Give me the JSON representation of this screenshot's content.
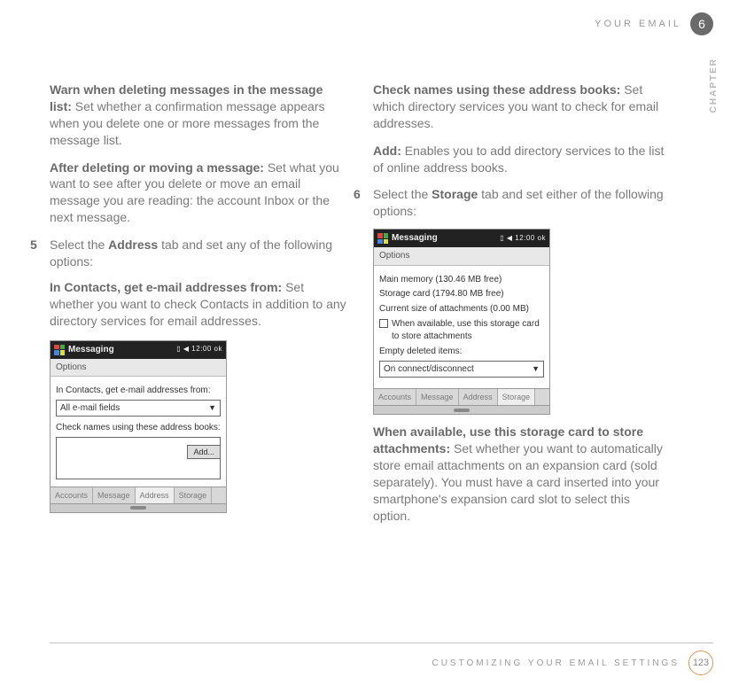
{
  "header": {
    "title": "YOUR EMAIL",
    "chapter_number": "6",
    "chapter_label": "CHAPTER"
  },
  "left": {
    "p1_bold": "Warn when deleting messages in the message list:",
    "p1_rest": " Set whether a confirmation message appears when you delete one or more messages from the message list.",
    "p2_bold": "After deleting or moving a message:",
    "p2_rest": " Set what you want to see after you delete or move an email message you are reading: the account Inbox or the next message.",
    "step5_num": "5",
    "step5_a": "Select the ",
    "step5_bold": "Address",
    "step5_b": " tab and set any of the following options:",
    "p3_bold": "In Contacts, get e-mail addresses from:",
    "p3_rest": " Set whether you want to check Contacts in addition to any directory services for email addresses.",
    "ss1": {
      "title": "Messaging",
      "status": "▯ ◀ 12:00  ok",
      "sub": "Options",
      "line1": "In Contacts, get e-mail addresses from:",
      "combo": "All e-mail fields",
      "line2": "Check names using these address books:",
      "add": "Add...",
      "tabs": [
        "Accounts",
        "Message",
        "Address",
        "Storage"
      ]
    }
  },
  "right": {
    "p1_bold": "Check names using these address books:",
    "p1_rest": " Set which directory services you want to check for email addresses.",
    "p2_bold": "Add:",
    "p2_rest": " Enables you to add directory services to the list of online address books.",
    "step6_num": "6",
    "step6_a": "Select the ",
    "step6_bold": "Storage",
    "step6_b": " tab and set either of the following options:",
    "ss2": {
      "title": "Messaging",
      "status": "▯ ◀ 12:00  ok",
      "sub": "Options",
      "mem1": "Main memory (130.46 MB free)",
      "mem2": "Storage card (1794.80 MB free)",
      "mem3": "Current size of attachments (0.00 MB)",
      "check": "When available, use this storage card to store attachments",
      "empty": "Empty deleted items:",
      "combo": "On connect/disconnect",
      "tabs": [
        "Accounts",
        "Message",
        "Address",
        "Storage"
      ]
    },
    "p3_bold": "When available, use this storage card to store attachments:",
    "p3_rest": " Set whether you want to automatically store email attachments on an expansion card (sold separately). You must have a card inserted into your smartphone's expansion card slot to select this option."
  },
  "footer": {
    "title": "CUSTOMIZING YOUR EMAIL SETTINGS",
    "page": "123"
  }
}
